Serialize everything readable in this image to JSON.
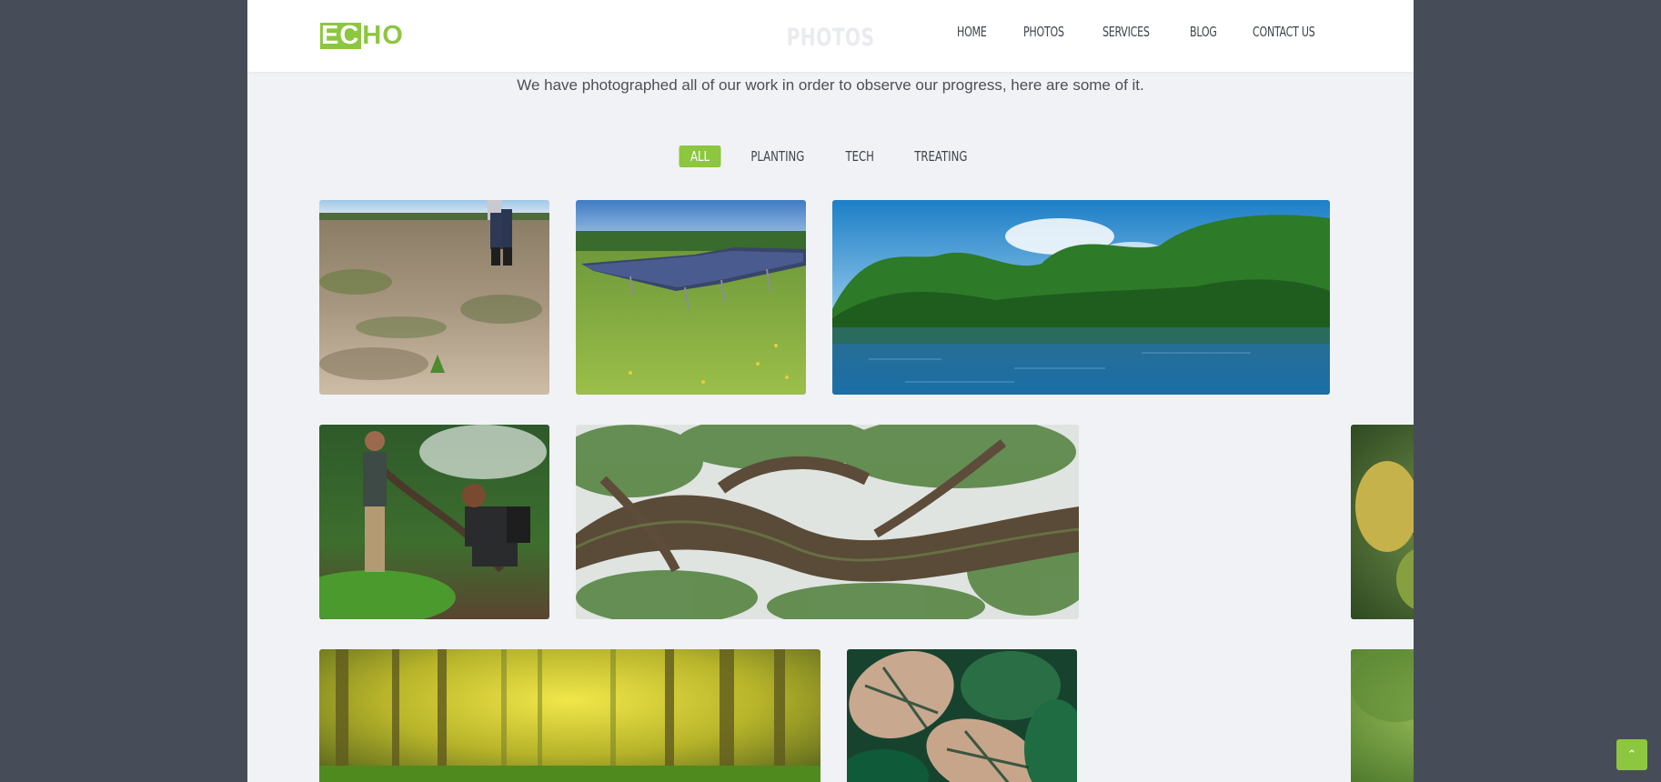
{
  "brand": {
    "logo_boxed": "EC",
    "logo_rest": "HO"
  },
  "nav": {
    "items": [
      {
        "label": "HOME"
      },
      {
        "label": "PHOTOS"
      },
      {
        "label": "SERVICES"
      },
      {
        "label": "BLOG"
      },
      {
        "label": "CONTACT US"
      }
    ]
  },
  "section": {
    "title": "PHOTOS",
    "subtitle": "We have photographed all of our work in order to observe our progress, here are some of it."
  },
  "filters": [
    {
      "label": "ALL",
      "active": true
    },
    {
      "label": "PLANTING",
      "active": false
    },
    {
      "label": "TECH",
      "active": false
    },
    {
      "label": "TREATING",
      "active": false
    }
  ],
  "gallery": {
    "photos": [
      {
        "subject": "planting-field"
      },
      {
        "subject": "solar-panels"
      },
      {
        "subject": "tropical-river"
      },
      {
        "subject": "people-planting"
      },
      {
        "subject": "tree-branches"
      },
      {
        "subject": "spotted-leaves"
      },
      {
        "subject": "sunlit-forest"
      },
      {
        "subject": "monstera-leaves"
      },
      {
        "subject": "stacked-stones"
      }
    ]
  },
  "scroll_top": {
    "icon": "chevron-up-icon"
  },
  "colors": {
    "accent": "#8dc63f",
    "outer_bg": "#474d58",
    "page_bg": "#f1f2f5"
  }
}
